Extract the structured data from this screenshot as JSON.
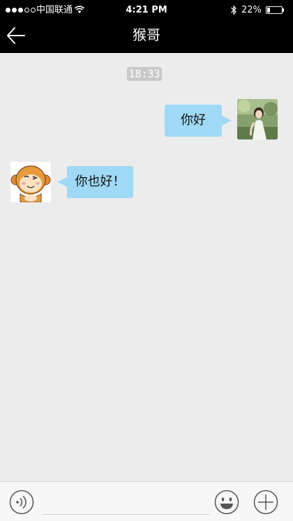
{
  "status_bar": {
    "carrier": "中国联通",
    "time": "4:21 PM",
    "battery": "22%",
    "battery_level": 0.22,
    "signal_bars": 3
  },
  "nav": {
    "title": "猴哥",
    "back_icon": "back-arrow-icon"
  },
  "conversation": {
    "timestamp": "18:33",
    "messages": [
      {
        "sender": "me",
        "text": "你好",
        "avatar": "girl-photo-avatar"
      },
      {
        "sender": "contact",
        "text": "你也好！",
        "avatar": "monkey-cartoon-avatar"
      }
    ],
    "bubble_color": "#9fd9f5"
  },
  "input_bar": {
    "left_button_icon": "voice-icon",
    "emoji_button_icon": "emoji-icon",
    "plus_button_icon": "plus-icon"
  },
  "colors": {
    "header": "#000000",
    "background": "#ececec"
  }
}
